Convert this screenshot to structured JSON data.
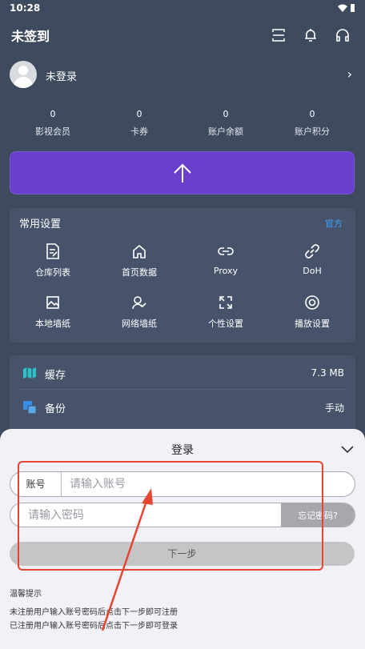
{
  "status_bar": {
    "time": "10:28"
  },
  "app_bar": {
    "title": "未签到",
    "icons": [
      "scan-icon",
      "bell-icon",
      "headset-icon"
    ]
  },
  "profile": {
    "name": "未登录"
  },
  "stats": [
    {
      "value": "0",
      "label": "影视会员"
    },
    {
      "value": "0",
      "label": "卡券"
    },
    {
      "value": "0",
      "label": "账户余额"
    },
    {
      "value": "0",
      "label": "账户积分"
    }
  ],
  "settings": {
    "title": "常用设置",
    "link": "官方",
    "items": [
      {
        "label": "仓库列表",
        "icon": "edit-list-icon"
      },
      {
        "label": "首页数据",
        "icon": "home-icon"
      },
      {
        "label": "Proxy",
        "icon": "link-icon"
      },
      {
        "label": "DoH",
        "icon": "chain-icon"
      },
      {
        "label": "本地墙纸",
        "icon": "image-icon"
      },
      {
        "label": "网络墙纸",
        "icon": "user-check-icon"
      },
      {
        "label": "个性设置",
        "icon": "expand-icon"
      },
      {
        "label": "播放设置",
        "icon": "play-circle-icon"
      }
    ]
  },
  "storage": [
    {
      "label": "缓存",
      "value": "7.3 MB",
      "icon": "map-icon"
    },
    {
      "label": "备份",
      "value": "手动",
      "icon": "copy-icon"
    }
  ],
  "login_sheet": {
    "title": "登录",
    "account_prefix": "账号",
    "account_placeholder": "请输入账号",
    "password_placeholder": "请输入密码",
    "forgot_label": "忘记密码?",
    "next_label": "下一步",
    "tips_title": "温馨提示",
    "tips": [
      "未注册用户输入账号密码后点击下一步即可注册",
      "已注册用户输入账号密码后点击下一步即可登录"
    ]
  },
  "colors": {
    "background": "#3e4a5e",
    "panel": "#46536a",
    "upload_button": "#6a3fcc",
    "link": "#3ca5ff",
    "annotation": "#e64532",
    "cache_icon": "#2cc0c8",
    "backup_icon": "#3a8ee6"
  }
}
